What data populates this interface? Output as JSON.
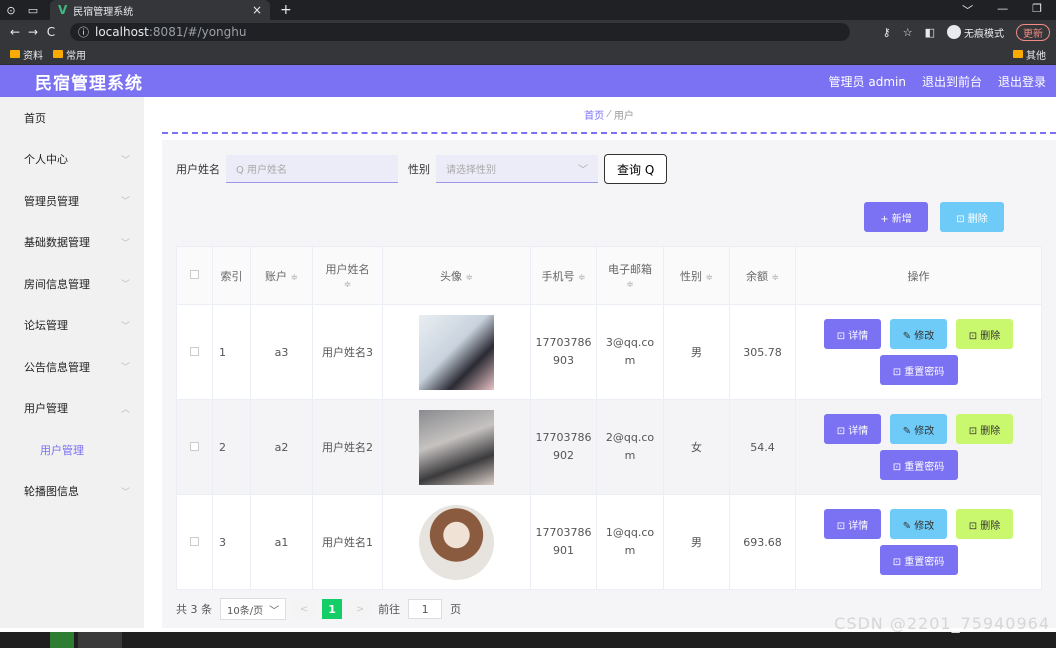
{
  "browser": {
    "tab_title": "民宿管理系统",
    "tab_close": "×",
    "new_tab": "+",
    "url_host": "localhost",
    "url_rest": ":8081/#/yonghu",
    "incognito_label": "无痕模式",
    "update_label": "更新",
    "bookmarks": [
      "资料",
      "常用"
    ],
    "other_bookmarks": "其他"
  },
  "header": {
    "title": "民宿管理系统",
    "user": "管理员 admin",
    "to_frontend": "退出到前台",
    "logout": "退出登录"
  },
  "sidebar": {
    "items": [
      {
        "label": "首页",
        "chev": ""
      },
      {
        "label": "个人中心",
        "chev": "﹀"
      },
      {
        "label": "管理员管理",
        "chev": "﹀"
      },
      {
        "label": "基础数据管理",
        "chev": "﹀"
      },
      {
        "label": "房间信息管理",
        "chev": "﹀"
      },
      {
        "label": "论坛管理",
        "chev": "﹀"
      },
      {
        "label": "公告信息管理",
        "chev": "﹀"
      },
      {
        "label": "用户管理",
        "chev": "︿"
      }
    ],
    "sub_item": "用户管理",
    "last_item": {
      "label": "轮播图信息",
      "chev": "﹀"
    }
  },
  "breadcrumb": {
    "home": "首页",
    "sep": "⁄",
    "current": "用户"
  },
  "search": {
    "name_label": "用户姓名",
    "name_placeholder": "Q 用户姓名",
    "sex_label": "性别",
    "sex_placeholder": "请选择性别",
    "query_button": "查询 Q"
  },
  "actions": {
    "add": "+ 新增",
    "delete": "⊡ 删除"
  },
  "table": {
    "headers": {
      "index": "索引",
      "account": "账户",
      "name": "用户姓名",
      "avatar": "头像",
      "phone": "手机号",
      "email": "电子邮箱",
      "sex": "性别",
      "balance": "余额",
      "ops": "操作",
      "sort": "≑"
    },
    "rows": [
      {
        "index": "1",
        "account": "a3",
        "name": "用户姓名3",
        "phone": "17703786903",
        "email": "3@qq.com",
        "sex": "男",
        "balance": "305.78"
      },
      {
        "index": "2",
        "account": "a2",
        "name": "用户姓名2",
        "phone": "17703786902",
        "email": "2@qq.com",
        "sex": "女",
        "balance": "54.4"
      },
      {
        "index": "3",
        "account": "a1",
        "name": "用户姓名1",
        "phone": "17703786901",
        "email": "1@qq.com",
        "sex": "男",
        "balance": "693.68"
      }
    ],
    "ops": {
      "detail": "⊡ 详情",
      "edit": "✎ 修改",
      "remove": "⊡ 删除",
      "reset": "⊡ 重置密码"
    }
  },
  "pager": {
    "total": "共 3 条",
    "size": "10条/页",
    "prev": "<",
    "current": "1",
    "next": ">",
    "goto": "前往",
    "goto_value": "1",
    "page_unit": "页"
  },
  "watermark": "CSDN @2201_75940964"
}
